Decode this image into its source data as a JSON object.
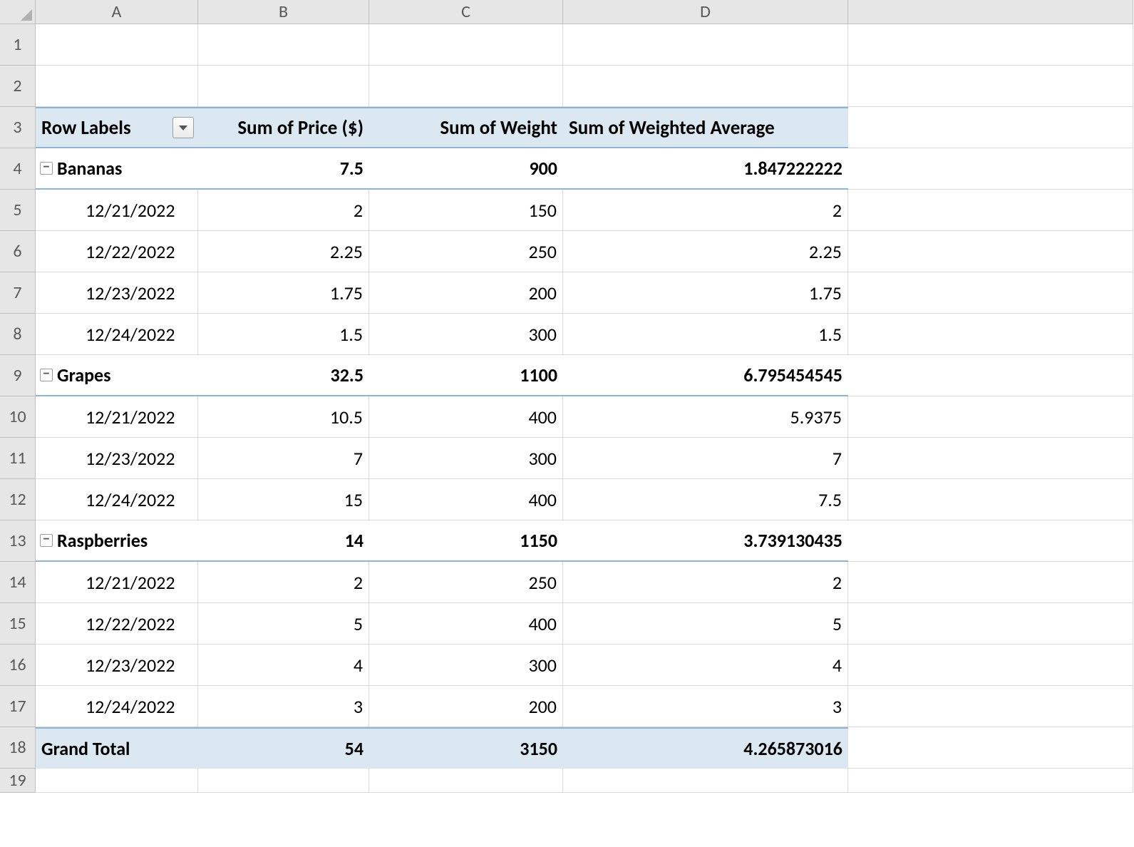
{
  "columns": [
    "A",
    "B",
    "C",
    "D",
    ""
  ],
  "rows": [
    "1",
    "2",
    "3",
    "4",
    "5",
    "6",
    "7",
    "8",
    "9",
    "10",
    "11",
    "12",
    "13",
    "14",
    "15",
    "16",
    "17",
    "18",
    "19"
  ],
  "pivot": {
    "headers": {
      "rowlabels": "Row Labels",
      "price": "Sum of Price ($)",
      "weight": "Sum of Weight",
      "wavg": "Sum of Weighted Average"
    },
    "groups": [
      {
        "name": "Bananas",
        "price": "7.5",
        "weight": "900",
        "wavg": "1.847222222",
        "rows": [
          {
            "label": "12/21/2022",
            "price": "2",
            "weight": "150",
            "wavg": "2"
          },
          {
            "label": "12/22/2022",
            "price": "2.25",
            "weight": "250",
            "wavg": "2.25"
          },
          {
            "label": "12/23/2022",
            "price": "1.75",
            "weight": "200",
            "wavg": "1.75"
          },
          {
            "label": "12/24/2022",
            "price": "1.5",
            "weight": "300",
            "wavg": "1.5"
          }
        ]
      },
      {
        "name": "Grapes",
        "price": "32.5",
        "weight": "1100",
        "wavg": "6.795454545",
        "rows": [
          {
            "label": "12/21/2022",
            "price": "10.5",
            "weight": "400",
            "wavg": "5.9375"
          },
          {
            "label": "12/23/2022",
            "price": "7",
            "weight": "300",
            "wavg": "7"
          },
          {
            "label": "12/24/2022",
            "price": "15",
            "weight": "400",
            "wavg": "7.5"
          }
        ]
      },
      {
        "name": "Raspberries",
        "price": "14",
        "weight": "1150",
        "wavg": "3.739130435",
        "rows": [
          {
            "label": "12/21/2022",
            "price": "2",
            "weight": "250",
            "wavg": "2"
          },
          {
            "label": "12/22/2022",
            "price": "5",
            "weight": "400",
            "wavg": "5"
          },
          {
            "label": "12/23/2022",
            "price": "4",
            "weight": "300",
            "wavg": "4"
          },
          {
            "label": "12/24/2022",
            "price": "3",
            "weight": "200",
            "wavg": "3"
          }
        ]
      }
    ],
    "grand": {
      "label": "Grand Total",
      "price": "54",
      "weight": "3150",
      "wavg": "4.265873016"
    }
  }
}
